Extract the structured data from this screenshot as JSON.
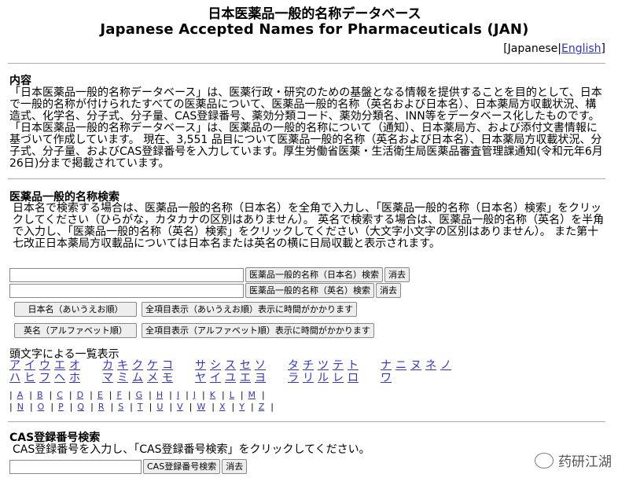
{
  "header": {
    "title_jp": "日本医薬品一般的名称データベース",
    "title_en": "Japanese Accepted Names for Pharmaceuticals (JAN)",
    "lang_open": "[",
    "lang_ja": "Japanese",
    "lang_sep": "|",
    "lang_en": "English",
    "lang_close": "]"
  },
  "contents": {
    "title": "内容",
    "text": "「日本医薬品一般的名称データベース」は、医薬行政・研究のための基盤となる情報を提供することを目的として、日本で一般的名称が付けられたすべての医薬品について、医薬品一般的名称（英名および日本名）、日本薬局方収載状況、構造式、化学名、分子式、分子量、CAS登録番号、薬効分類コード、薬効分類名、INN等をデータベース化したものです。「日本医薬品一般的名称データベース」は、医薬品の一般的名称について（通知）、日本薬局方、および添付文書情報に基づいて作成しています。 現在、3,551 品目について医薬品一般的名称（英名および日本名）、日本薬局方収載状況、分子式、分子量、およびCAS登録番号を入力しています。厚生労働省医薬・生活衛生局医薬品審査管理課通知(令和元年6月26日)分まで掲載されています。"
  },
  "search": {
    "title": "医薬品一般的名称検索",
    "text": "日本名で検索する場合は、医薬品一般的名称（日本名）を全角で入力し、「医薬品一般的名称（日本名）検索」をクリックしてください（ひらがな，カタカナの区別はありません）。 英名で検索する場合は、医薬品一般的名称（英名）を半角で入力し、「医薬品一般的名称（英名）検索」をクリックしてください（大文字小文字の区別はありません）。 また第十七改正日本薬局方収載品については日本名または英名の横に日局収載と表示されます。",
    "jp_input_value": "",
    "jp_search_label": "医薬品一般的名称（日本名）検索",
    "jp_clear_label": "消去",
    "en_input_value": "",
    "en_search_label": "医薬品一般的名称（英名）検索",
    "en_clear_label": "消去",
    "btn_jp_order": "日本名（あいうえお順）",
    "btn_all_jp": "全項目表示（あいうえお順）表示に時間がかかります",
    "btn_en_order": "英名（アルファベット順）",
    "btn_all_en": "全項目表示（アルファベット順）表示に時間がかかります"
  },
  "index": {
    "title": "頭文字による一覧表示",
    "kana_row1": [
      "ア",
      "イ",
      "ウ",
      "エ",
      "オ",
      "カ",
      "キ",
      "ク",
      "ケ",
      "コ",
      "サ",
      "シ",
      "ス",
      "セ",
      "ソ",
      "タ",
      "チ",
      "ツ",
      "テ",
      "ト",
      "ナ",
      "ニ",
      "ヌ",
      "ネ",
      "ノ"
    ],
    "kana_row2": [
      "ハ",
      "ヒ",
      "フ",
      "ヘ",
      "ホ",
      "マ",
      "ミ",
      "ム",
      "メ",
      "モ",
      "ヤ",
      "イ",
      "ユ",
      "エ",
      "ヨ",
      "ラ",
      "リ",
      "ル",
      "レ",
      "ロ",
      "ワ"
    ],
    "alpha_row1": [
      "A",
      "B",
      "C",
      "D",
      "E",
      "F",
      "G",
      "H",
      "I",
      "J",
      "K",
      "L",
      "M"
    ],
    "alpha_row2": [
      "N",
      "O",
      "P",
      "Q",
      "R",
      "S",
      "T",
      "U",
      "V",
      "W",
      "X",
      "Y",
      "Z"
    ]
  },
  "cas": {
    "title": "CAS登録番号検索",
    "text": "CAS登録番号を入力し、「CAS登録番号検索」をクリックしてください。",
    "input_value": "",
    "search_label": "CAS登録番号検索",
    "clear_label": "消去"
  },
  "watermark": {
    "text": "药研江湖",
    "icon": "wechat-logo-icon"
  }
}
